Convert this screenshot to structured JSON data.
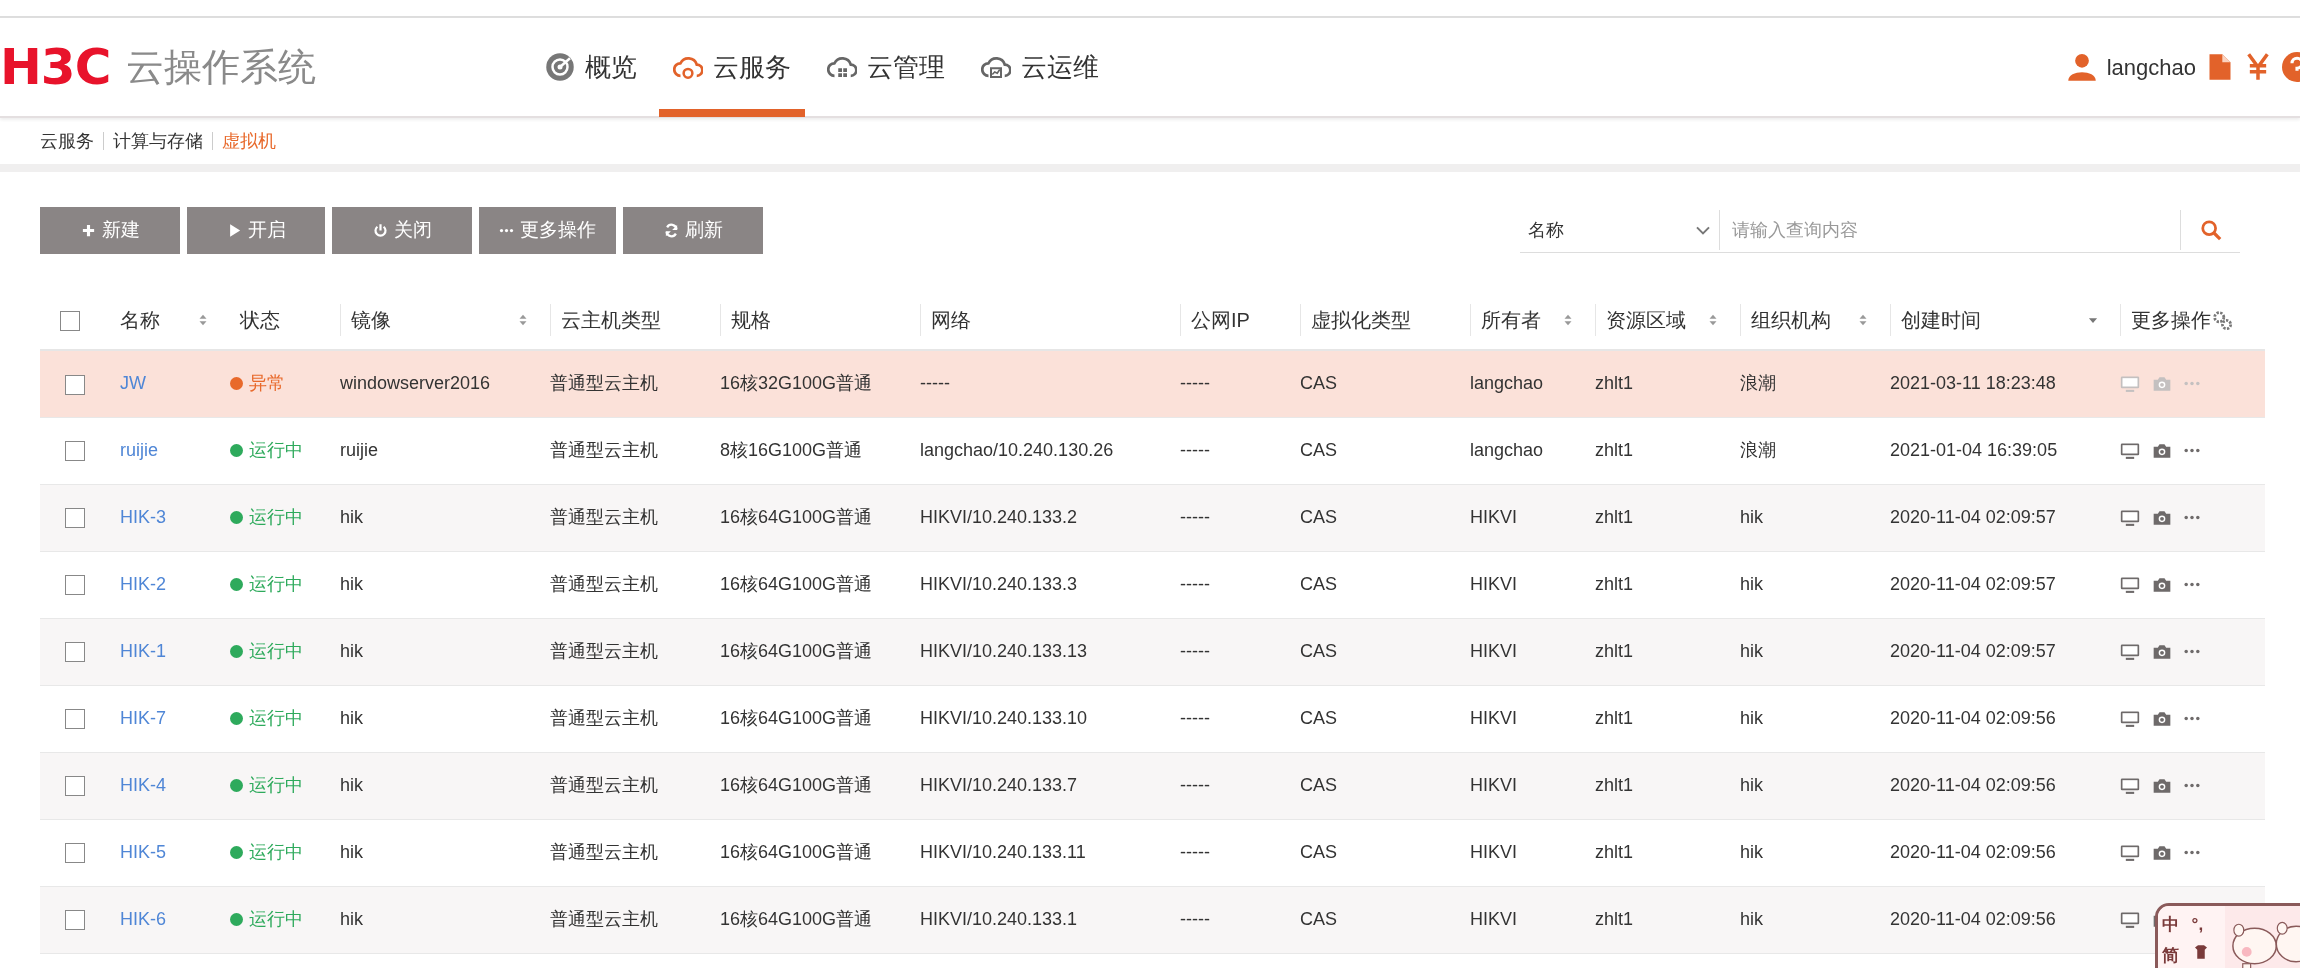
{
  "brand": {
    "logo": "H3C",
    "title": "云操作系统"
  },
  "nav": [
    {
      "label": "概览",
      "selected": false
    },
    {
      "label": "云服务",
      "selected": true
    },
    {
      "label": "云管理",
      "selected": false
    },
    {
      "label": "云运维",
      "selected": false
    }
  ],
  "user": {
    "name": "langchao"
  },
  "breadcrumb": [
    {
      "label": "云服务",
      "selected": false
    },
    {
      "label": "计算与存储",
      "selected": false
    },
    {
      "label": "虚拟机",
      "selected": true
    }
  ],
  "toolbar": [
    {
      "label": "新建"
    },
    {
      "label": "开启"
    },
    {
      "label": "关闭"
    },
    {
      "label": "更多操作"
    },
    {
      "label": "刷新"
    }
  ],
  "search": {
    "field": "名称",
    "placeholder": "请输入查询内容"
  },
  "table": {
    "select_all": false,
    "columns": [
      {
        "label": "名称",
        "sortable": true,
        "sorted": false
      },
      {
        "label": "状态",
        "sortable": false,
        "sorted": false
      },
      {
        "label": "镜像",
        "sortable": true,
        "sorted": false
      },
      {
        "label": "云主机类型",
        "sortable": false,
        "sorted": false
      },
      {
        "label": "规格",
        "sortable": false,
        "sorted": false
      },
      {
        "label": "网络",
        "sortable": false,
        "sorted": false
      },
      {
        "label": "公网IP",
        "sortable": false,
        "sorted": false
      },
      {
        "label": "虚拟化类型",
        "sortable": false,
        "sorted": false
      },
      {
        "label": "所有者",
        "sortable": true,
        "sorted": false
      },
      {
        "label": "资源区域",
        "sortable": true,
        "sorted": false
      },
      {
        "label": "组织机构",
        "sortable": true,
        "sorted": false
      },
      {
        "label": "创建时间",
        "sorted": true
      },
      {
        "label": "更多操作",
        "sortable": false,
        "sorted": false
      }
    ],
    "rows": [
      {
        "checked": false,
        "highlighted": true,
        "actions_disabled": true,
        "name": "JW",
        "status": {
          "label": "异常",
          "color": "#e8692b"
        },
        "image": "windowserver2016",
        "type": "普通型云主机",
        "spec": "16核32G100G普通",
        "network": "-----",
        "public_ip": "-----",
        "virt": "CAS",
        "owner": "langchao",
        "zone": "zhlt1",
        "org": "浪潮",
        "created": "2021-03-11 18:23:48"
      },
      {
        "checked": false,
        "highlighted": false,
        "actions_disabled": false,
        "name": "ruijie",
        "status": {
          "label": "运行中",
          "color": "#2eaa5c"
        },
        "image": "ruijie",
        "type": "普通型云主机",
        "spec": "8核16G100G普通",
        "network": "langchao/10.240.130.26",
        "public_ip": "-----",
        "virt": "CAS",
        "owner": "langchao",
        "zone": "zhlt1",
        "org": "浪潮",
        "created": "2021-01-04 16:39:05"
      },
      {
        "checked": false,
        "highlighted": false,
        "actions_disabled": false,
        "name": "HIK-3",
        "status": {
          "label": "运行中",
          "color": "#2eaa5c"
        },
        "image": "hik",
        "type": "普通型云主机",
        "spec": "16核64G100G普通",
        "network": "HIKVI/10.240.133.2",
        "public_ip": "-----",
        "virt": "CAS",
        "owner": "HIKVI",
        "zone": "zhlt1",
        "org": "hik",
        "created": "2020-11-04 02:09:57"
      },
      {
        "checked": false,
        "highlighted": false,
        "actions_disabled": false,
        "name": "HIK-2",
        "status": {
          "label": "运行中",
          "color": "#2eaa5c"
        },
        "image": "hik",
        "type": "普通型云主机",
        "spec": "16核64G100G普通",
        "network": "HIKVI/10.240.133.3",
        "public_ip": "-----",
        "virt": "CAS",
        "owner": "HIKVI",
        "zone": "zhlt1",
        "org": "hik",
        "created": "2020-11-04 02:09:57"
      },
      {
        "checked": false,
        "highlighted": false,
        "actions_disabled": false,
        "name": "HIK-1",
        "status": {
          "label": "运行中",
          "color": "#2eaa5c"
        },
        "image": "hik",
        "type": "普通型云主机",
        "spec": "16核64G100G普通",
        "network": "HIKVI/10.240.133.13",
        "public_ip": "-----",
        "virt": "CAS",
        "owner": "HIKVI",
        "zone": "zhlt1",
        "org": "hik",
        "created": "2020-11-04 02:09:57"
      },
      {
        "checked": false,
        "highlighted": false,
        "actions_disabled": false,
        "name": "HIK-7",
        "status": {
          "label": "运行中",
          "color": "#2eaa5c"
        },
        "image": "hik",
        "type": "普通型云主机",
        "spec": "16核64G100G普通",
        "network": "HIKVI/10.240.133.10",
        "public_ip": "-----",
        "virt": "CAS",
        "owner": "HIKVI",
        "zone": "zhlt1",
        "org": "hik",
        "created": "2020-11-04 02:09:56"
      },
      {
        "checked": false,
        "highlighted": false,
        "actions_disabled": false,
        "name": "HIK-4",
        "status": {
          "label": "运行中",
          "color": "#2eaa5c"
        },
        "image": "hik",
        "type": "普通型云主机",
        "spec": "16核64G100G普通",
        "network": "HIKVI/10.240.133.7",
        "public_ip": "-----",
        "virt": "CAS",
        "owner": "HIKVI",
        "zone": "zhlt1",
        "org": "hik",
        "created": "2020-11-04 02:09:56"
      },
      {
        "checked": false,
        "highlighted": false,
        "actions_disabled": false,
        "name": "HIK-5",
        "status": {
          "label": "运行中",
          "color": "#2eaa5c"
        },
        "image": "hik",
        "type": "普通型云主机",
        "spec": "16核64G100G普通",
        "network": "HIKVI/10.240.133.11",
        "public_ip": "-----",
        "virt": "CAS",
        "owner": "HIKVI",
        "zone": "zhlt1",
        "org": "hik",
        "created": "2020-11-04 02:09:56"
      },
      {
        "checked": false,
        "highlighted": false,
        "actions_disabled": false,
        "name": "HIK-6",
        "status": {
          "label": "运行中",
          "color": "#2eaa5c"
        },
        "image": "hik",
        "type": "普通型云主机",
        "spec": "16核64G100G普通",
        "network": "HIKVI/10.240.133.1",
        "public_ip": "-----",
        "virt": "CAS",
        "owner": "HIKVI",
        "zone": "zhlt1",
        "org": "hik",
        "created": "2020-11-04 02:09:56"
      }
    ]
  },
  "ime": {
    "mode": "中",
    "punct": "°,",
    "script": "简"
  }
}
